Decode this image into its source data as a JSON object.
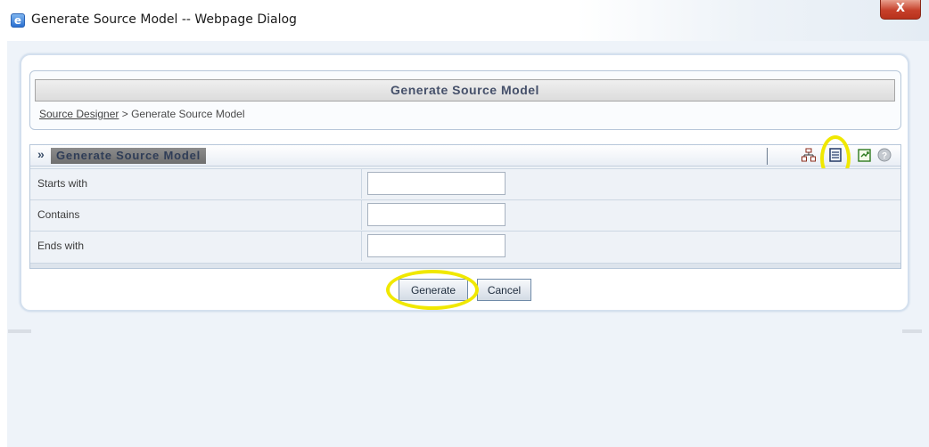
{
  "window": {
    "title": "Generate Source Model -- Webpage Dialog",
    "close_label": "X"
  },
  "page": {
    "header_title": "Generate Source Model",
    "breadcrumb": {
      "link": "Source Designer",
      "separator": ">",
      "current": "Generate Source Model"
    }
  },
  "section": {
    "chevron": "»",
    "title": "Generate Source Model",
    "toolbar_icons": [
      "hierarchy-icon",
      "list-view-icon",
      "export-icon",
      "help-icon"
    ]
  },
  "form": {
    "rows": [
      {
        "label": "Starts with",
        "value": ""
      },
      {
        "label": "Contains",
        "value": ""
      },
      {
        "label": "Ends with",
        "value": ""
      }
    ]
  },
  "buttons": {
    "generate": "Generate",
    "cancel": "Cancel"
  },
  "colors": {
    "highlight": "#f0e800",
    "header_text": "#45506a"
  }
}
